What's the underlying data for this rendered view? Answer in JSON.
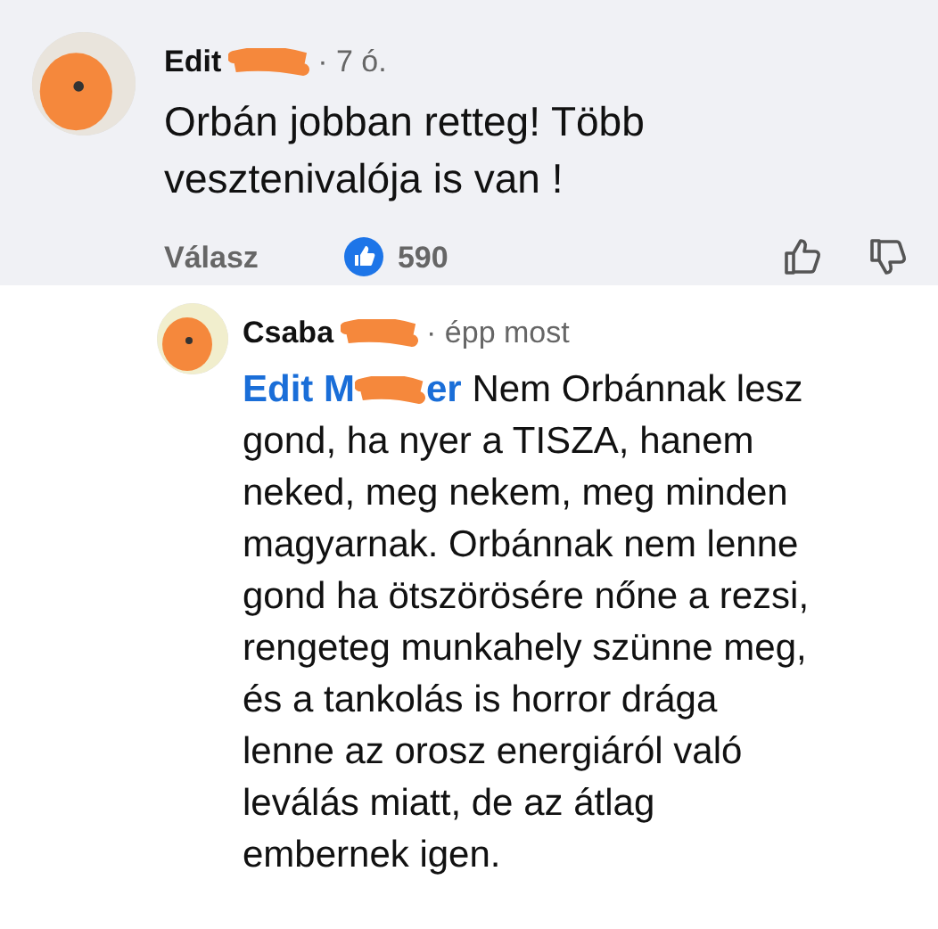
{
  "comment": {
    "author": "Edit",
    "author_redacted": true,
    "time": "· 7 ó.",
    "text_lines": [
      "Orbán jobban retteg! Több",
      "vesztenivalója is van !"
    ],
    "actions": {
      "reply": "Válasz",
      "like_count": "590"
    }
  },
  "reply": {
    "author": "Csaba",
    "author_redacted": true,
    "time": "· épp most",
    "mention_start": "Edit M",
    "mention_end": "er",
    "text_lines": [
      "Nem Orbánnak lesz",
      "gond, ha nyer a TISZA, hanem",
      "neked, meg nekem, meg minden",
      "magyarnak. Orbánnak nem lenne",
      "gond ha ötszörösére nőne a rezsi,",
      "rengeteg munkahely szünne meg,",
      "és a tankolás is horror drága",
      "lenne az orosz energiáról való",
      "leválás miatt, de az átlag",
      "embernek igen."
    ]
  }
}
